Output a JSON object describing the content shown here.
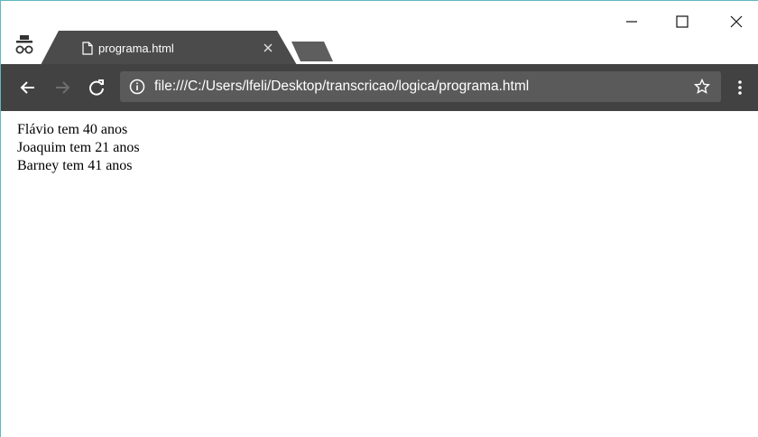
{
  "browser": {
    "tab": {
      "title": "programa.html"
    },
    "address_bar": {
      "url": "file:///C:/Users/lfeli/Desktop/transcricao/logica/programa.html"
    },
    "theme": {
      "toolbar": "#424242",
      "omnibox": "#5a5a5a",
      "tab": "#4b4b4b",
      "new_tab": "#5e5e5e"
    },
    "icons": [
      "incognito-icon",
      "page-icon",
      "close-icon",
      "minimize-icon",
      "maximize-icon",
      "back-icon",
      "forward-icon",
      "reload-icon",
      "info-icon",
      "star-icon",
      "menu-icon"
    ]
  },
  "page": {
    "lines": [
      "Flávio tem 40 anos",
      "Joaquim tem 21 anos",
      "Barney tem 41 anos"
    ]
  }
}
